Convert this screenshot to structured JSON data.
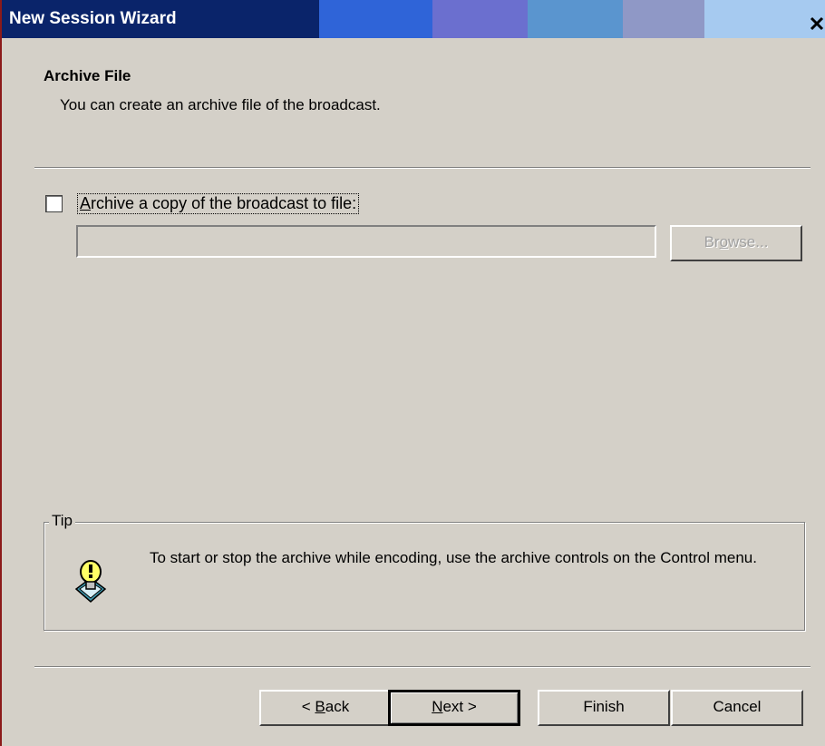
{
  "window": {
    "title": "New Session Wizard",
    "close_glyph": "✕"
  },
  "header": {
    "title": "Archive File",
    "subtitle": "You can create an archive file of the broadcast."
  },
  "archive": {
    "checkbox_label_mnemonic": "A",
    "checkbox_label_rest": "rchive a copy of the broadcast to file:",
    "checked": false,
    "path_value": "",
    "browse_pre": "Br",
    "browse_mnemonic": "o",
    "browse_post": "wse..."
  },
  "tip": {
    "legend": "Tip",
    "text": "To start or stop the archive while encoding, use the archive controls on the Control menu.",
    "icon": "lightbulb-tip-icon"
  },
  "buttons": {
    "back_pre": "< ",
    "back_mnemonic": "B",
    "back_post": "ack",
    "next_mnemonic": "N",
    "next_post": "ext >",
    "finish": "Finish",
    "cancel": "Cancel"
  }
}
